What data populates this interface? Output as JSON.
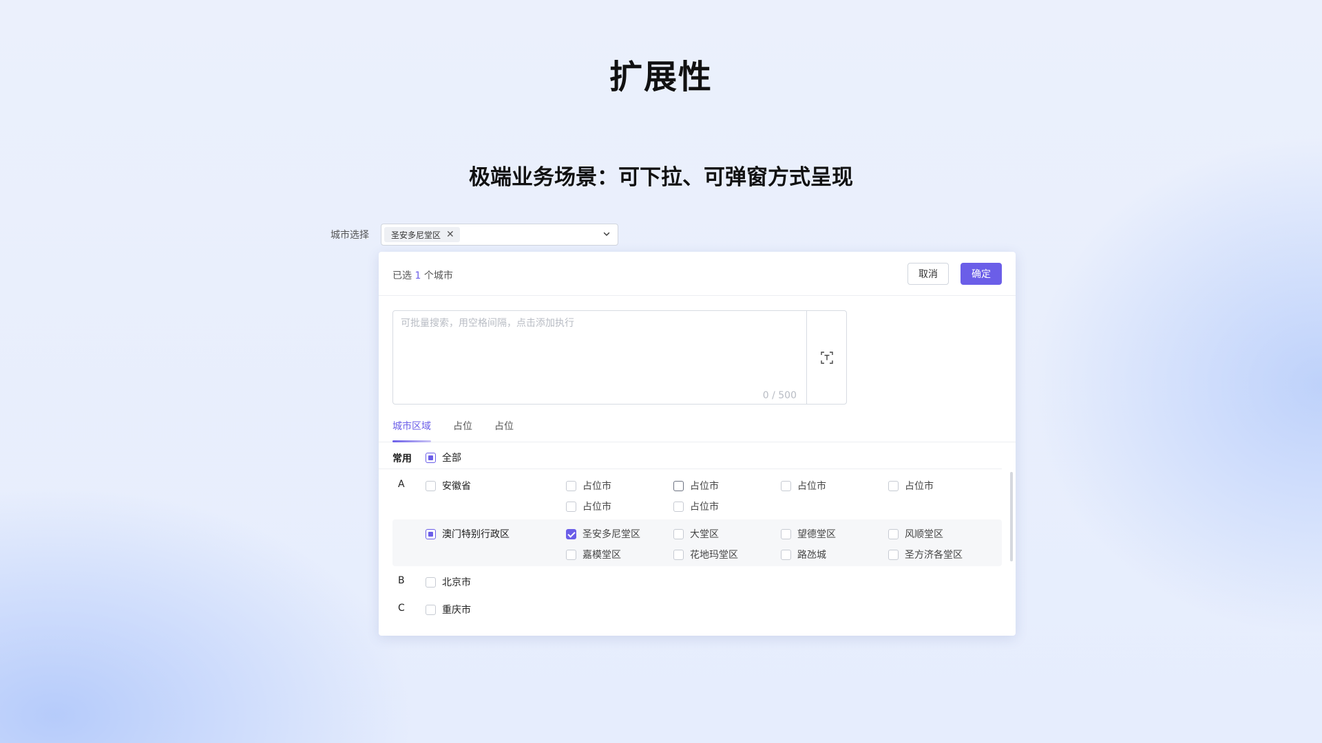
{
  "page_title": "扩展性",
  "subtitle": "极端业务场景：可下拉、可弹窗方式呈现",
  "city_select": {
    "label": "城市选择",
    "tag": "圣安多尼堂区"
  },
  "panel": {
    "selected_prefix": "已选 ",
    "selected_count": "1",
    "selected_suffix": " 个城市",
    "cancel_label": "取消",
    "confirm_label": "确定",
    "search_placeholder": "可批量搜索，用空格间隔，点击添加执行",
    "counter": "0 / 500",
    "tabs": [
      "城市区域",
      "占位",
      "占位"
    ]
  },
  "common": {
    "label": "常用",
    "all_label": "全部"
  },
  "groups": {
    "A": {
      "letter": "A",
      "anhui": {
        "name": "安徽省",
        "cities": [
          "占位市",
          "占位市",
          "占位市",
          "占位市",
          "占位市",
          "占位市"
        ]
      },
      "macau": {
        "name": "澳门特别行政区",
        "cities": [
          "圣安多尼堂区",
          "大堂区",
          "望德堂区",
          "风顺堂区",
          "嘉模堂区",
          "花地玛堂区",
          "路氹城",
          "圣方济各堂区"
        ]
      }
    },
    "B": {
      "letter": "B",
      "name": "北京市"
    },
    "C": {
      "letter": "C",
      "name": "重庆市"
    }
  },
  "colors": {
    "accent": "#6b5ee8"
  }
}
